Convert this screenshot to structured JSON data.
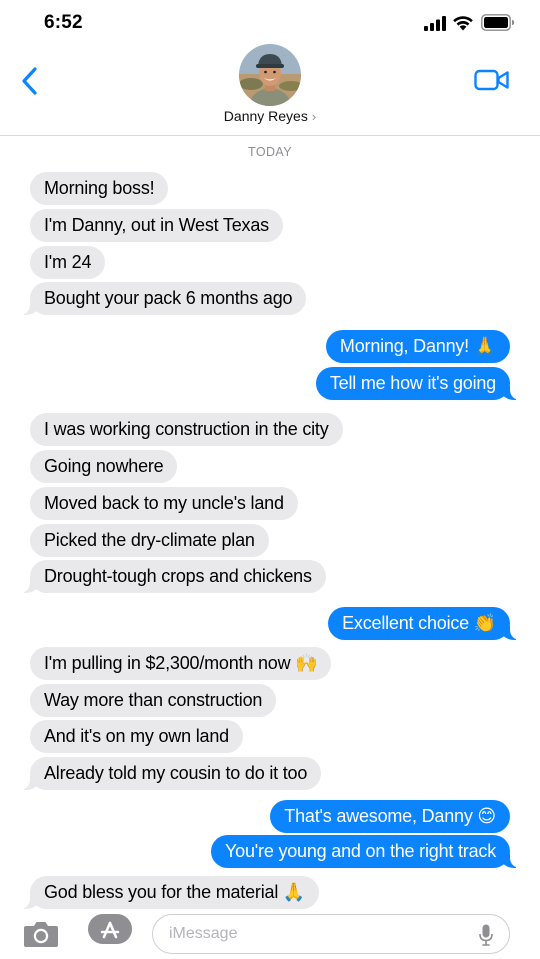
{
  "status": {
    "time": "6:52"
  },
  "header": {
    "contact_name": "Danny Reyes",
    "chevron": "›"
  },
  "thread": {
    "day_label": "TODAY",
    "messages": [
      {
        "dir": "in",
        "text": "Morning boss!"
      },
      {
        "dir": "in",
        "text": "I'm Danny, out in West Texas"
      },
      {
        "dir": "in",
        "text": "I'm 24"
      },
      {
        "dir": "in",
        "text": "Bought your pack 6 months ago",
        "tail": true
      },
      {
        "dir": "out",
        "text": "Morning, Danny! 🙏"
      },
      {
        "dir": "out",
        "text": "Tell me how it's going",
        "tail": true
      },
      {
        "dir": "in",
        "text": "I was working construction in the city"
      },
      {
        "dir": "in",
        "text": "Going nowhere"
      },
      {
        "dir": "in",
        "text": "Moved back to my uncle's land"
      },
      {
        "dir": "in",
        "text": "Picked the dry-climate plan"
      },
      {
        "dir": "in",
        "text": "Drought-tough crops and chickens",
        "tail": true
      },
      {
        "dir": "out",
        "text": "Excellent choice 👏",
        "tail": true
      },
      {
        "dir": "in",
        "text": "I'm pulling in $2,300/month now 🙌"
      },
      {
        "dir": "in",
        "text": "Way more than construction"
      },
      {
        "dir": "in",
        "text": "And it's on my own land"
      },
      {
        "dir": "in",
        "text": "Already told my cousin to do it too",
        "tail": true
      },
      {
        "dir": "out",
        "text": "That's awesome, Danny 😊"
      },
      {
        "dir": "out",
        "text": "You're young and on the right track",
        "tail": true
      },
      {
        "dir": "in",
        "text": "God bless you for the material 🙏",
        "tail": true
      }
    ]
  },
  "composer": {
    "placeholder": "iMessage"
  },
  "icons": {
    "back": "chevron-left-icon",
    "video": "video-camera-icon",
    "camera": "camera-icon",
    "apps": "app-store-icon",
    "mic": "microphone-icon",
    "signal": "cellular-signal-icon",
    "wifi": "wifi-icon",
    "battery": "battery-icon"
  },
  "colors": {
    "accent": "#0b84fe",
    "incoming_bubble": "#e9e9eb",
    "meta_gray": "#8e8e93"
  }
}
